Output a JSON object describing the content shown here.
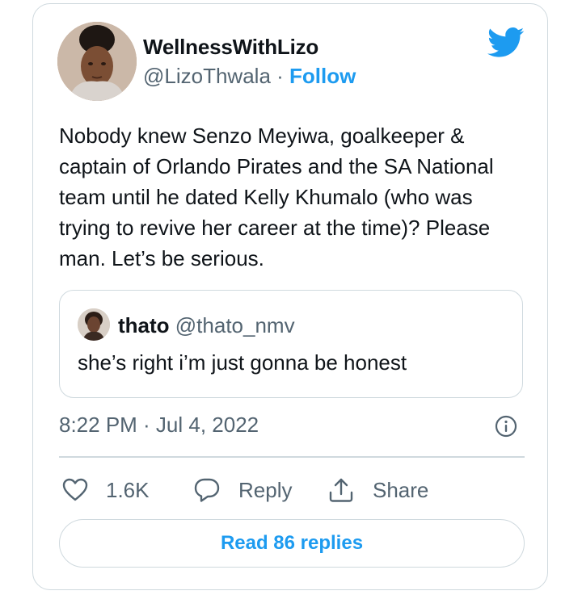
{
  "author": {
    "display_name": "WellnessWithLizo",
    "handle": "@LizoThwala",
    "separator": "·",
    "follow_label": "Follow"
  },
  "tweet": {
    "text": "Nobody knew Senzo Meyiwa, goalkeeper & captain of Orlando Pirates and the SA National team until he dated Kelly Khumalo (who was trying to revive her career at the time)? Please man. Let’s be serious."
  },
  "quoted_tweet": {
    "display_name": "thato",
    "handle": "@thato_nmv",
    "text": "she’s right i’m just gonna be honest"
  },
  "meta": {
    "timestamp": "8:22 PM · Jul 4, 2022"
  },
  "actions": {
    "like_count": "1.6K",
    "reply_label": "Reply",
    "share_label": "Share"
  },
  "read_replies_label": "Read 86 replies",
  "icons": {
    "brand": "twitter-bird-icon",
    "info": "info-icon",
    "like": "heart-icon",
    "reply": "speech-bubble-icon",
    "share": "share-upload-icon"
  },
  "colors": {
    "accent": "#1d9bf0",
    "text_primary": "#0f1419",
    "text_secondary": "#536471",
    "border": "#cfd9de"
  }
}
